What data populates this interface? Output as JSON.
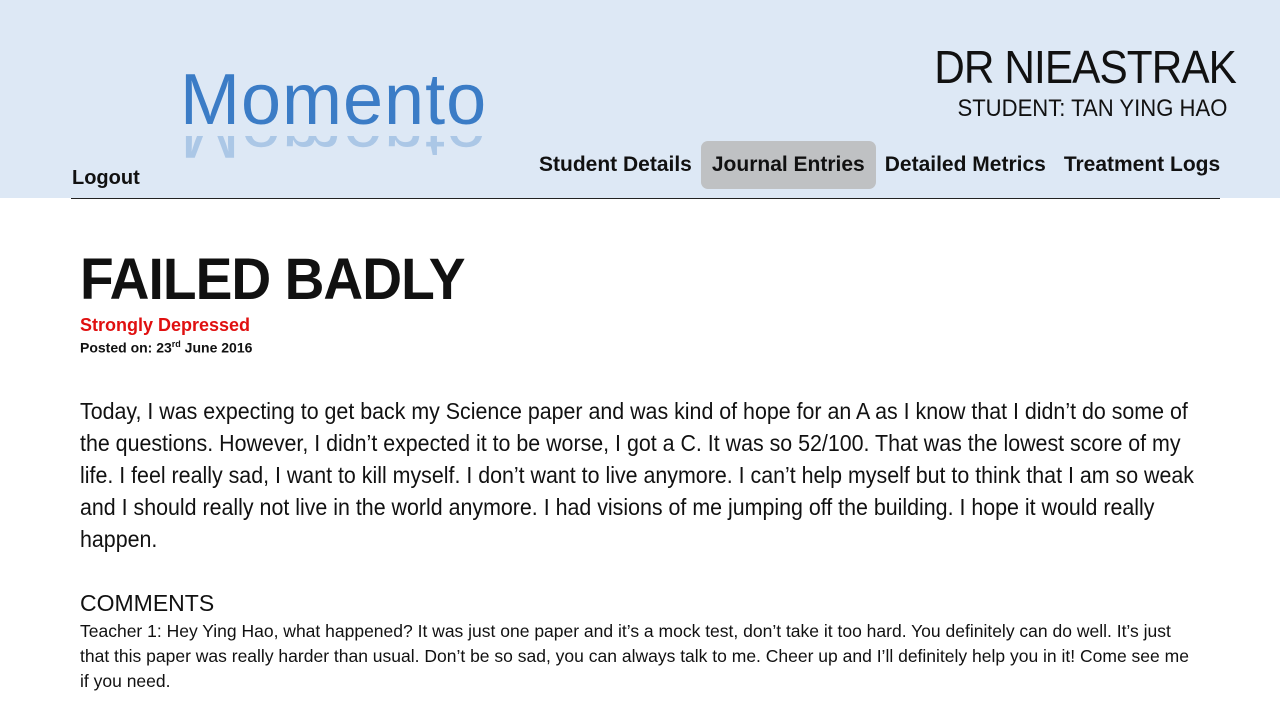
{
  "app": {
    "logo_text": "Momento",
    "logout_label": "Logout",
    "doctor_name": "DR NIEASTRAK",
    "student_label": "STUDENT: TAN YING HAO"
  },
  "nav": {
    "items": [
      {
        "label": "Student Details",
        "active": false
      },
      {
        "label": "Journal Entries",
        "active": true
      },
      {
        "label": "Detailed Metrics",
        "active": false
      },
      {
        "label": "Treatment Logs",
        "active": false
      }
    ]
  },
  "entry": {
    "title": "FAILED BADLY",
    "mood": "Strongly Depressed",
    "posted_prefix": "Posted on: 23",
    "posted_suffix": "rd",
    "posted_rest": " June 2016",
    "body": "Today, I was expecting to get back my Science paper and was kind of hope for an A as I know that I didn’t do some of the questions. However, I didn’t expected it to be worse, I got a C. It was so 52/100. That was the lowest score of my life. I feel really sad, I want to kill myself. I don’t want to live anymore. I can’t help myself but to think that I am so weak and I should really not live in the world anymore. I had visions of me jumping off the building. I hope it would really happen."
  },
  "comments": {
    "heading": "COMMENTS",
    "items": [
      {
        "text": "Teacher 1: Hey Ying Hao, what happened? It was just one paper and it’s a mock test, don’t take it too hard. You definitely can do well. It’s just that this paper was really harder than usual. Don’t be so sad, you can always talk to me. Cheer up and I’ll definitely help you in it! Come see me if you need."
      }
    ]
  },
  "colors": {
    "header_bg": "#dde8f5",
    "logo": "#3b7cc6",
    "mood": "#e01010",
    "active_tab": "#bfc1c3"
  }
}
